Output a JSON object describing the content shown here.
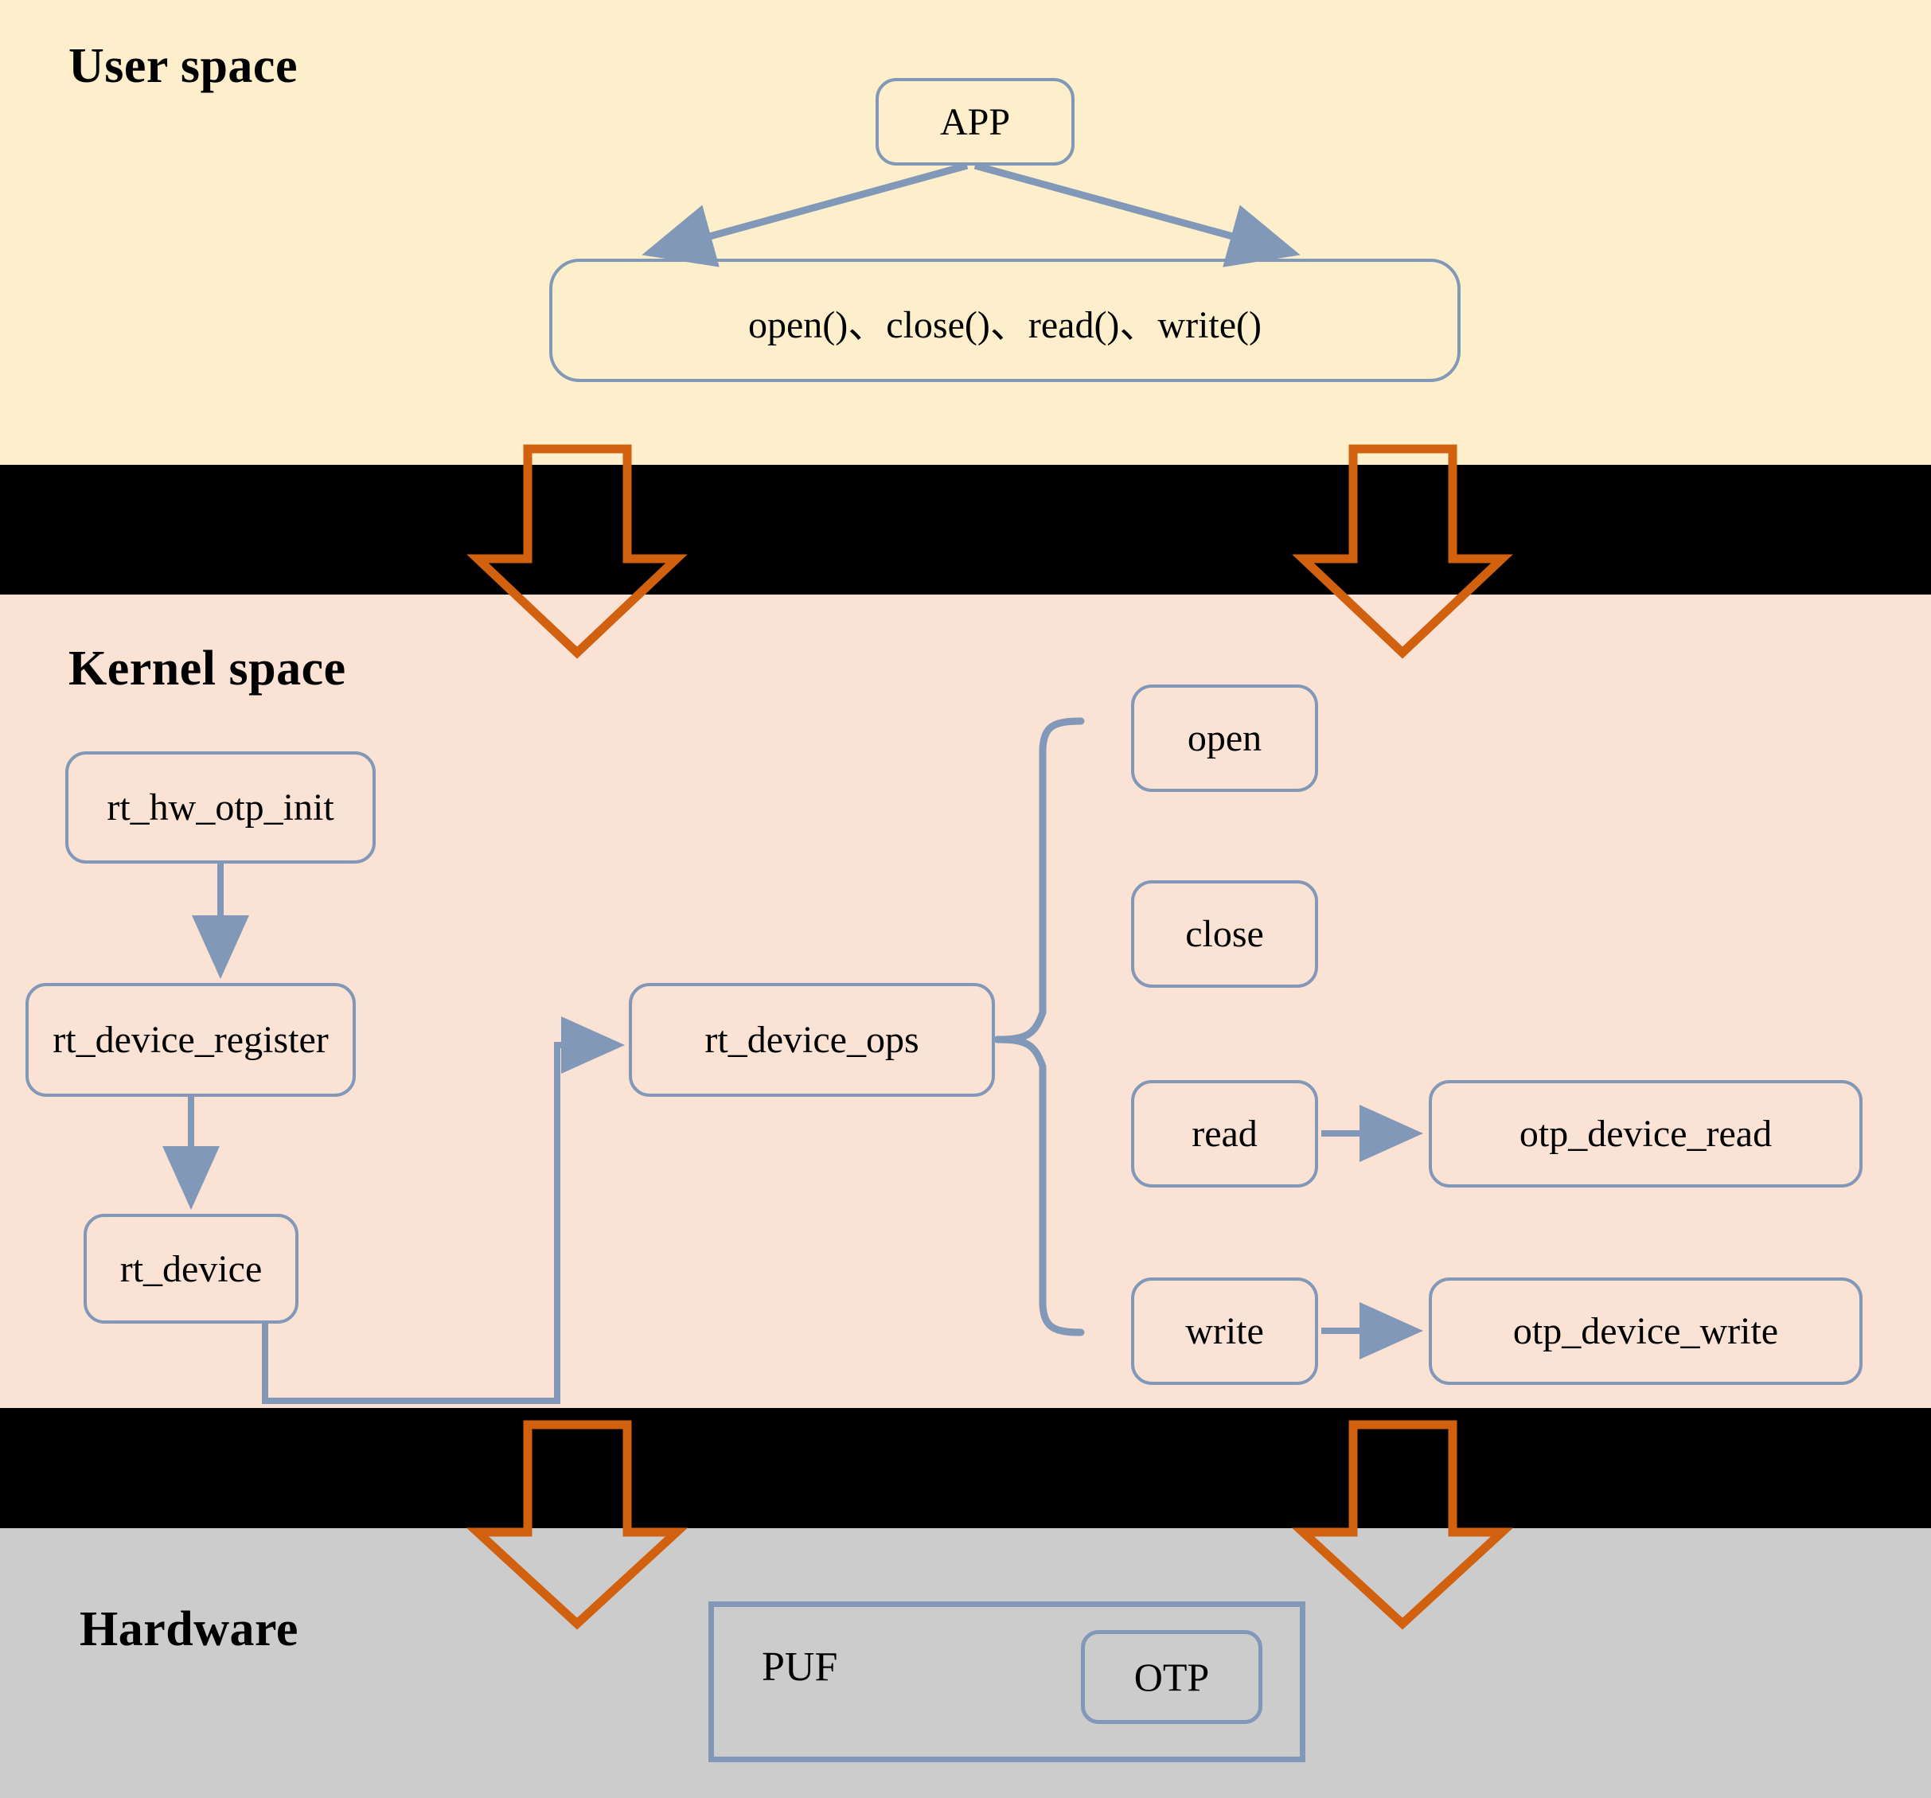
{
  "diagram": {
    "title_hidden": "",
    "sections": [
      {
        "key": "user",
        "label": "User space",
        "bg": "#FDEFCB"
      },
      {
        "key": "kernel",
        "label": "Kernel space",
        "bg": "#FAE2D5"
      },
      {
        "key": "hardware",
        "label": "Hardware",
        "bg": "#CCCCCC"
      }
    ],
    "colors": {
      "user_space_bg": "#FDEFCB",
      "kernel_space_bg": "#FAE2D5",
      "hardware_bg": "#CCCCCC",
      "divider_band": "#000000",
      "node_border": "#8198B8",
      "connector": "#8198B8",
      "block_arrow": "#D1600F",
      "text": "#000000"
    }
  },
  "user_space": {
    "heading": "User space",
    "nodes": {
      "app": "APP",
      "syscalls": "open()、close()、read()、write()"
    }
  },
  "kernel_space": {
    "heading": "Kernel space",
    "nodes": {
      "rt_hw_otp_init": "rt_hw_otp_init",
      "rt_device_register": "rt_device_register",
      "rt_device": "rt_device",
      "rt_device_ops": "rt_device_ops",
      "open": "open",
      "close": "close",
      "read": "read",
      "write": "write",
      "otp_device_read": "otp_device_read",
      "otp_device_write": "otp_device_write"
    }
  },
  "hardware": {
    "heading": "Hardware",
    "nodes": {
      "puf": "PUF",
      "otp": "OTP"
    }
  },
  "icons": {
    "block_arrow_down": "down-block-arrow",
    "arrow_head": "arrowhead"
  }
}
